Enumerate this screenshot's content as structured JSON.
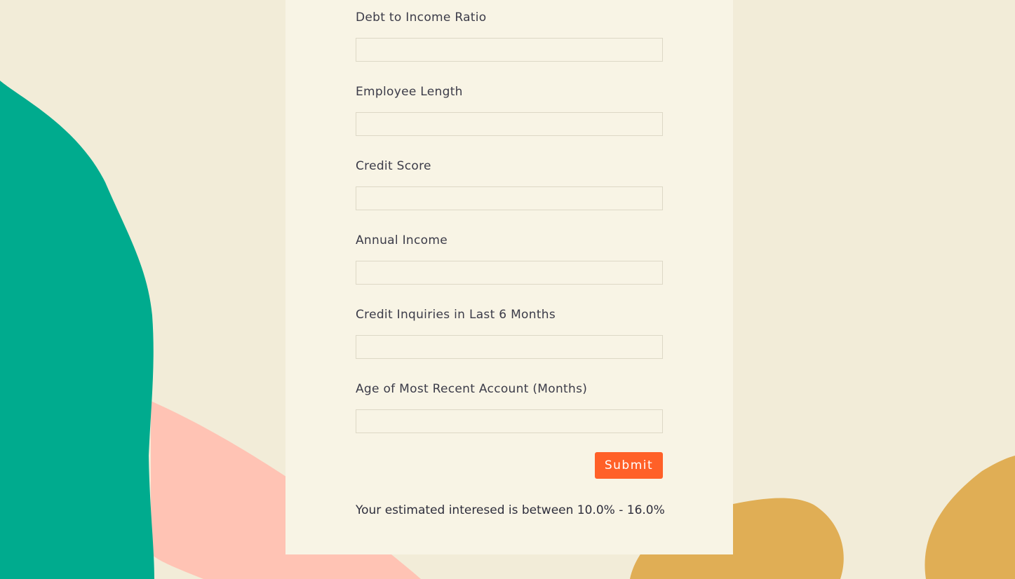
{
  "colors": {
    "page_background": "#f2ecd8",
    "card_background": "#f8f4e5",
    "accent_button": "#ff6028",
    "shape_green": "#00ab8e",
    "shape_pink": "#ffc3b4",
    "shape_gold": "#e0ae55"
  },
  "form": {
    "fields": [
      {
        "label": "Debt to Income Ratio",
        "value": ""
      },
      {
        "label": "Employee Length",
        "value": ""
      },
      {
        "label": "Credit Score",
        "value": ""
      },
      {
        "label": "Annual Income",
        "value": ""
      },
      {
        "label": "Credit Inquiries in Last 6 Months",
        "value": ""
      },
      {
        "label": "Age of Most Recent Account (Months)",
        "value": ""
      }
    ],
    "submit_label": "Submit",
    "result": "Your estimated interesed is between 10.0% - 16.0%"
  }
}
